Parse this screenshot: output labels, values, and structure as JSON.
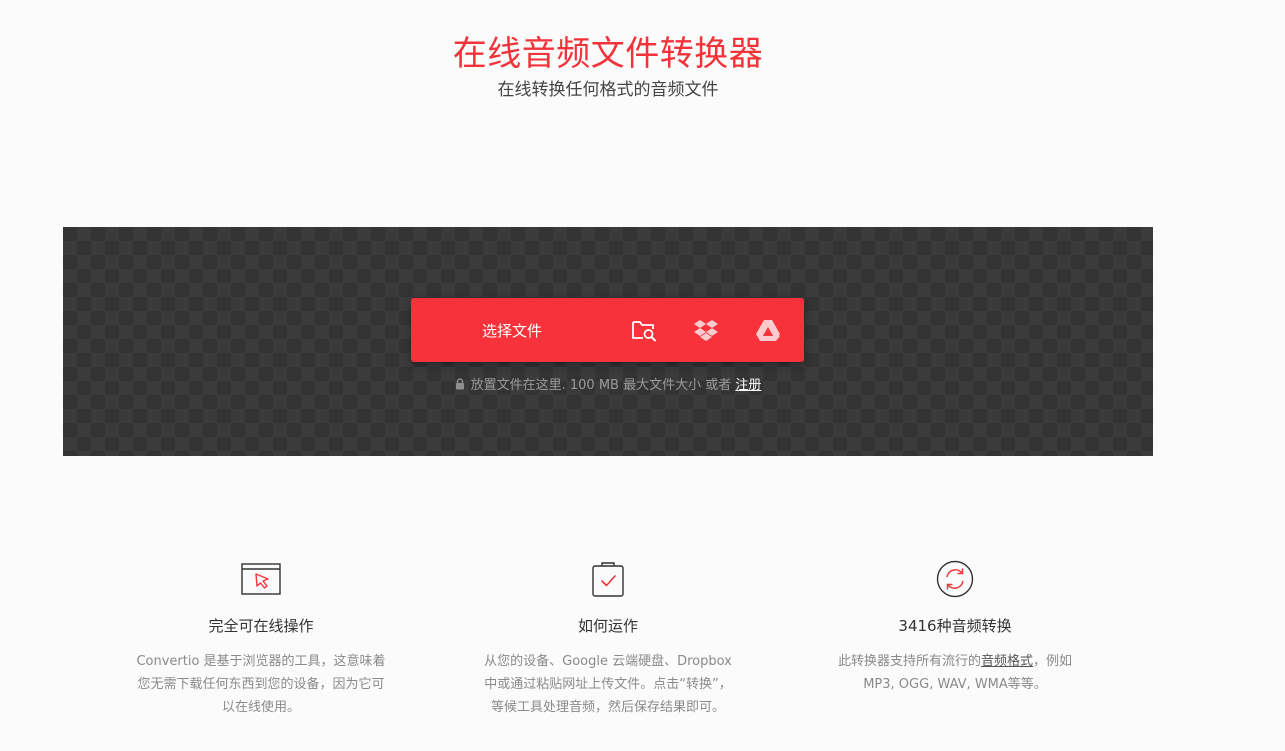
{
  "hero": {
    "title": "在线音频文件转换器",
    "subtitle": "在线转换任何格式的音频文件"
  },
  "upload": {
    "choose_file_label": "选择文件",
    "sources": [
      {
        "name": "folder-search-icon"
      },
      {
        "name": "dropbox-icon"
      },
      {
        "name": "google-drive-icon"
      }
    ],
    "hint_text": "放置文件在这里. 100 MB 最大文件大小 或者",
    "signup_label": "注册"
  },
  "features": [
    {
      "icon": "browser-cursor-icon",
      "title": "完全可在线操作",
      "desc": "Convertio 是基于浏览器的工具，这意味着您无需下载任何东西到您的设备，因为它可以在线使用。"
    },
    {
      "icon": "clipboard-check-icon",
      "title": "如何运作",
      "desc": "从您的设备、Google 云端硬盘、Dropbox 中或通过粘贴网址上传文件。点击“转换”，等候工具处理音频，然后保存结果即可。"
    },
    {
      "icon": "refresh-circle-icon",
      "title": "3416种音频转换",
      "desc_before": "此转换器支持所有流行的",
      "desc_link": "音频格式",
      "desc_after": "，例如MP3, OGG, WAV, WMA等等。"
    }
  ],
  "colors": {
    "accent": "#f7323a",
    "title_red": "#f2333a",
    "dropzone_bg": "#333333"
  }
}
